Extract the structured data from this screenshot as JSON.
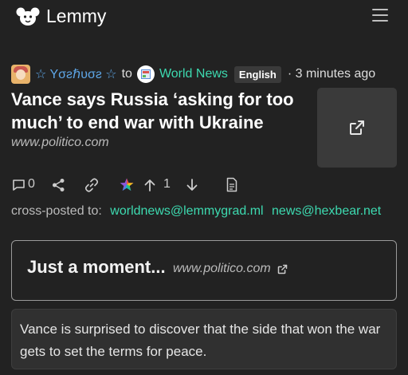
{
  "app": {
    "name": "Lemmy"
  },
  "post": {
    "author": "☆ Yσƨℏυσƨ ☆",
    "to_label": "to",
    "community": "World News",
    "language": "English",
    "time": "· 3 minutes ago",
    "title": "Vance says Russia ‘asking for too much’ to end war with Ukraine",
    "domain": "www.politico.com",
    "comment_count": "0",
    "score": "1",
    "crosspost_label": "cross-posted to:",
    "crossposts": [
      "worldnews@lemmygrad.ml",
      "news@hexbear.net"
    ],
    "embed": {
      "title": "Just a moment...",
      "domain": "www.politico.com"
    },
    "body": "Vance is surprised to discover that the side that won the war gets to set the terms for peace."
  },
  "icons": {
    "logo": "lemmy-mouse-icon",
    "menu": "hamburger-icon",
    "comments": "comment-icon",
    "share": "share-icon",
    "link": "link-icon",
    "award": "colorful-star-icon",
    "upvote": "arrow-up-icon",
    "downvote": "arrow-down-icon",
    "source": "document-icon",
    "external": "external-link-icon"
  },
  "colors": {
    "background": "#222222",
    "accent": "#3ddab0",
    "user": "#5ea7e8"
  }
}
